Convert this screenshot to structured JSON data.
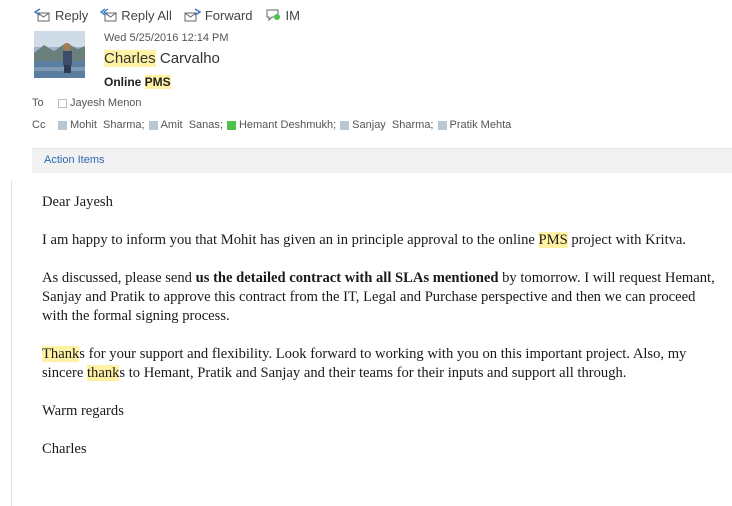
{
  "toolbar": {
    "reply": "Reply",
    "reply_all": "Reply All",
    "forward": "Forward",
    "im": "IM"
  },
  "header": {
    "date": "Wed 5/25/2016 12:14 PM",
    "sender_first": "Charles",
    "sender_last": "Carvalho",
    "subject_prefix": "Online ",
    "subject_highlight": "PMS"
  },
  "to": {
    "label": "To",
    "recipients": [
      {
        "name": "Jayesh Menon",
        "presence": "offline"
      }
    ]
  },
  "cc": {
    "label": "Cc",
    "recipients": [
      {
        "name": "Mohit  Sharma;",
        "presence": "away"
      },
      {
        "name": "Amit  Sanas;",
        "presence": "away"
      },
      {
        "name": "Hemant Deshmukh;",
        "presence": "available"
      },
      {
        "name": "Sanjay  Sharma;",
        "presence": "away"
      },
      {
        "name": "Pratik Mehta",
        "presence": "away"
      }
    ]
  },
  "action_items_label": "Action Items",
  "body": {
    "greeting": "Dear Jayesh",
    "p1_a": "I am happy to inform you that Mohit has given an in principle approval to the online ",
    "p1_hl": "PMS",
    "p1_b": " project with Kritva.",
    "p2_a": "As discussed, please send ",
    "p2_bold": "us the detailed contract with all SLAs mentioned",
    "p2_b": " by tomorrow. I will request Hemant, Sanjay and Pratik to approve this contract from the IT, Legal and Purchase perspective and then we can proceed with the formal signing process.",
    "p3_hl1": "Thank",
    "p3_a": "s for your support and flexibility. Look forward to working with you on this important project. Also, my sincere ",
    "p3_hl2": "thank",
    "p3_b": "s to Hemant, Pratik and Sanjay and their teams for their inputs and support all through.",
    "closing": "Warm regards",
    "signature": "Charles"
  },
  "colors": {
    "highlight": "#fff3a3",
    "link": "#2a6ab0",
    "presence_available": "#4cc24c",
    "presence_away": "#b8c7d4"
  }
}
